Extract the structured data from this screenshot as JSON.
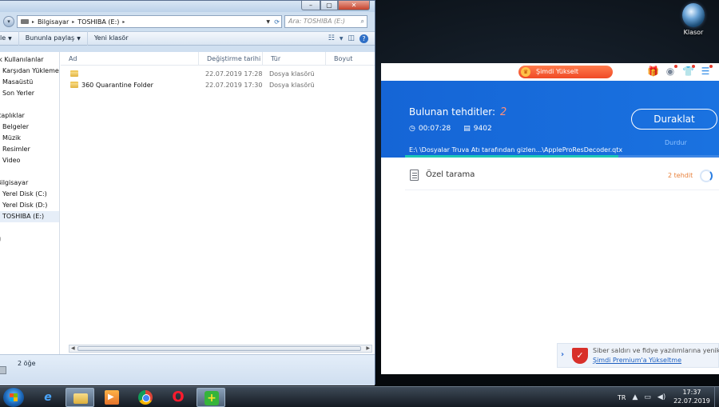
{
  "desktop": {
    "icon_label": "Klasor"
  },
  "explorer": {
    "address": {
      "crumbs": [
        "Bilgisayar",
        "TOSHIBA (E:)"
      ],
      "separator": "▸"
    },
    "search_placeholder": "Ara: TOSHIBA (E:)",
    "toolbar": {
      "organize_label": "le",
      "share_label": "Bununla paylaş",
      "new_folder_label": "Yeni klasör"
    },
    "nav": [
      {
        "label": "ık Kullanılanlar",
        "kind": "top"
      },
      {
        "label": "Karşıdan Yüklemeler",
        "kind": "sub"
      },
      {
        "label": "Masaüstü",
        "kind": "sub"
      },
      {
        "label": "Son Yerler",
        "kind": "sub"
      },
      {
        "label": "",
        "kind": "gap"
      },
      {
        "label": "itaplıklar",
        "kind": "top"
      },
      {
        "label": "Belgeler",
        "kind": "sub"
      },
      {
        "label": "Müzik",
        "kind": "sub"
      },
      {
        "label": "Resimler",
        "kind": "sub"
      },
      {
        "label": "Video",
        "kind": "sub"
      },
      {
        "label": "",
        "kind": "gap"
      },
      {
        "label": "Bilgisayar",
        "kind": "top"
      },
      {
        "label": "Yerel Disk (C:)",
        "kind": "sub"
      },
      {
        "label": "Yerel Disk (D:)",
        "kind": "sub"
      },
      {
        "label": "TOSHIBA (E:)",
        "kind": "sub-sel"
      },
      {
        "label": "",
        "kind": "gap"
      },
      {
        "label": "ğ",
        "kind": "top"
      }
    ],
    "columns": {
      "name": "Ad",
      "date": "Değiştirme tarihi",
      "type": "Tür",
      "size": "Boyut"
    },
    "files": [
      {
        "name": "",
        "date": "22.07.2019 17:28",
        "type": "Dosya klasörü"
      },
      {
        "name": "360 Quarantine Folder",
        "date": "22.07.2019 17:30",
        "type": "Dosya klasörü"
      }
    ],
    "status": {
      "count": "2 öğe"
    }
  },
  "antivirus": {
    "upgrade_label": "Şimdi Yükselt",
    "found_label": "Bulunan tehditler:",
    "found_count": "2",
    "elapsed": "00:07:28",
    "scanned": "9402",
    "pause_label": "Duraklat",
    "stop_label": "Durdur",
    "current_path": "E:\\ \\Dosyalar Truva Atı tarafından gizlen...\\AppleProResDecoder.qtx",
    "progress": 0.68,
    "scan_name": "Özel tarama",
    "scan_threats": "2 tehdit",
    "notice": {
      "line1": "Siber saldırı ve fidye yazılımlarına yenik du",
      "line2": "Şimdi Premium'a Yükseltme"
    },
    "colors": {
      "header_blue": "#1565d6",
      "upgrade_orange": "#f04a26",
      "threat_orange": "#e8803a",
      "progress_teal": "#1cc7b6"
    }
  },
  "taskbar": {
    "apps": [
      "internet-explorer-icon",
      "windows-explorer-icon",
      "media-player-icon",
      "chrome-icon",
      "opera-icon",
      "360-security-icon"
    ],
    "language": "TR",
    "time": "17:37",
    "date": "22.07.2019"
  }
}
